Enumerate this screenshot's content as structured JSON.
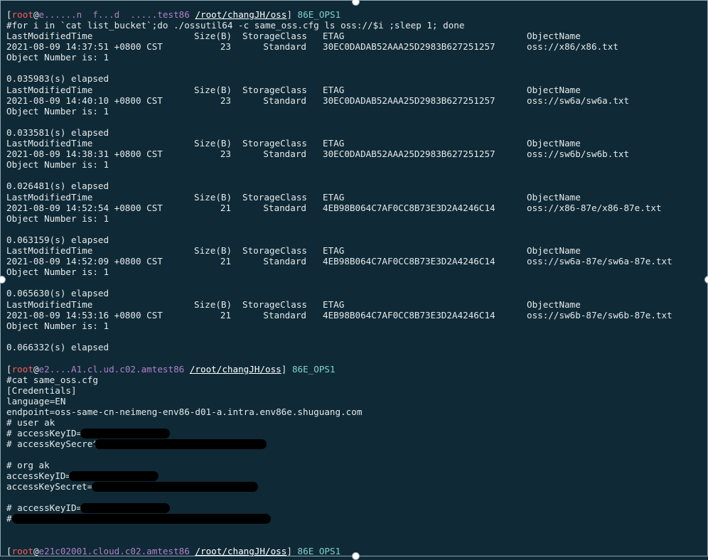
{
  "prompt": {
    "open": "[",
    "user": "root",
    "at": "@",
    "host1": "e......n  f...d  .....test86",
    "host2": "e2....A1.cl.ud.c02.amtest86",
    "host3": "e21c02001.cloud.c02.amtest86",
    "space": " ",
    "path": "/root/changJH/oss",
    "close": "]",
    "label": "86E_OPS1"
  },
  "cmd1": "#for i in `cat list_bucket`;do ./ossutil64 -c same_oss.cfg ls oss://$i ;sleep 1; done",
  "headers": {
    "time": "LastModifiedTime",
    "size": "Size(B)",
    "class": "StorageClass",
    "etag": "ETAG",
    "name": "ObjectName"
  },
  "object_number": "Object Number is: 1",
  "elapsed": [
    "0.035983(s) elapsed",
    "0.033581(s) elapsed",
    "0.026481(s) elapsed",
    "0.063159(s) elapsed",
    "0.065630(s) elapsed",
    "0.066332(s) elapsed"
  ],
  "listings": [
    {
      "time": "2021-08-09 14:37:51 +0800 CST",
      "size": "23",
      "class": "Standard",
      "etag": "30EC0DADAB52AAA25D2983B627251257",
      "name": "oss://x86/x86.txt"
    },
    {
      "time": "2021-08-09 14:40:10 +0800 CST",
      "size": "23",
      "class": "Standard",
      "etag": "30EC0DADAB52AAA25D2983B627251257",
      "name": "oss://sw6a/sw6a.txt"
    },
    {
      "time": "2021-08-09 14:38:31 +0800 CST",
      "size": "23",
      "class": "Standard",
      "etag": "30EC0DADAB52AAA25D2983B627251257",
      "name": "oss://sw6b/sw6b.txt"
    },
    {
      "time": "2021-08-09 14:52:54 +0800 CST",
      "size": "21",
      "class": "Standard",
      "etag": "4EB98B064C7AF0CC8B73E3D2A4246C14",
      "name": "oss://x86-87e/x86-87e.txt"
    },
    {
      "time": "2021-08-09 14:52:09 +0800 CST",
      "size": "21",
      "class": "Standard",
      "etag": "4EB98B064C7AF0CC8B73E3D2A4246C14",
      "name": "oss://sw6a-87e/sw6a-87e.txt"
    },
    {
      "time": "2021-08-09 14:53:16 +0800 CST",
      "size": "21",
      "class": "Standard",
      "etag": "4EB98B064C7AF0CC8B73E3D2A4246C14",
      "name": "oss://sw6b-87e/sw6b-87e.txt"
    }
  ],
  "cmd2": "#cat same_oss.cfg",
  "cfg": {
    "section": "[Credentials]",
    "language": "language=EN",
    "endpoint": "endpoint=oss-same-cn-neimeng-env86-d01-a.intra.env86e.shuguang.com",
    "user_ak": "# user ak",
    "user_key_id": "# accessKeyID=",
    "user_secret": "# accessKeySecret",
    "org_ak": "# org ak",
    "org_key_id": "accessKeyID=",
    "org_secret": "accessKeySecret=",
    "other_key_id": "# accessKeyID=",
    "other_secret": "#"
  }
}
